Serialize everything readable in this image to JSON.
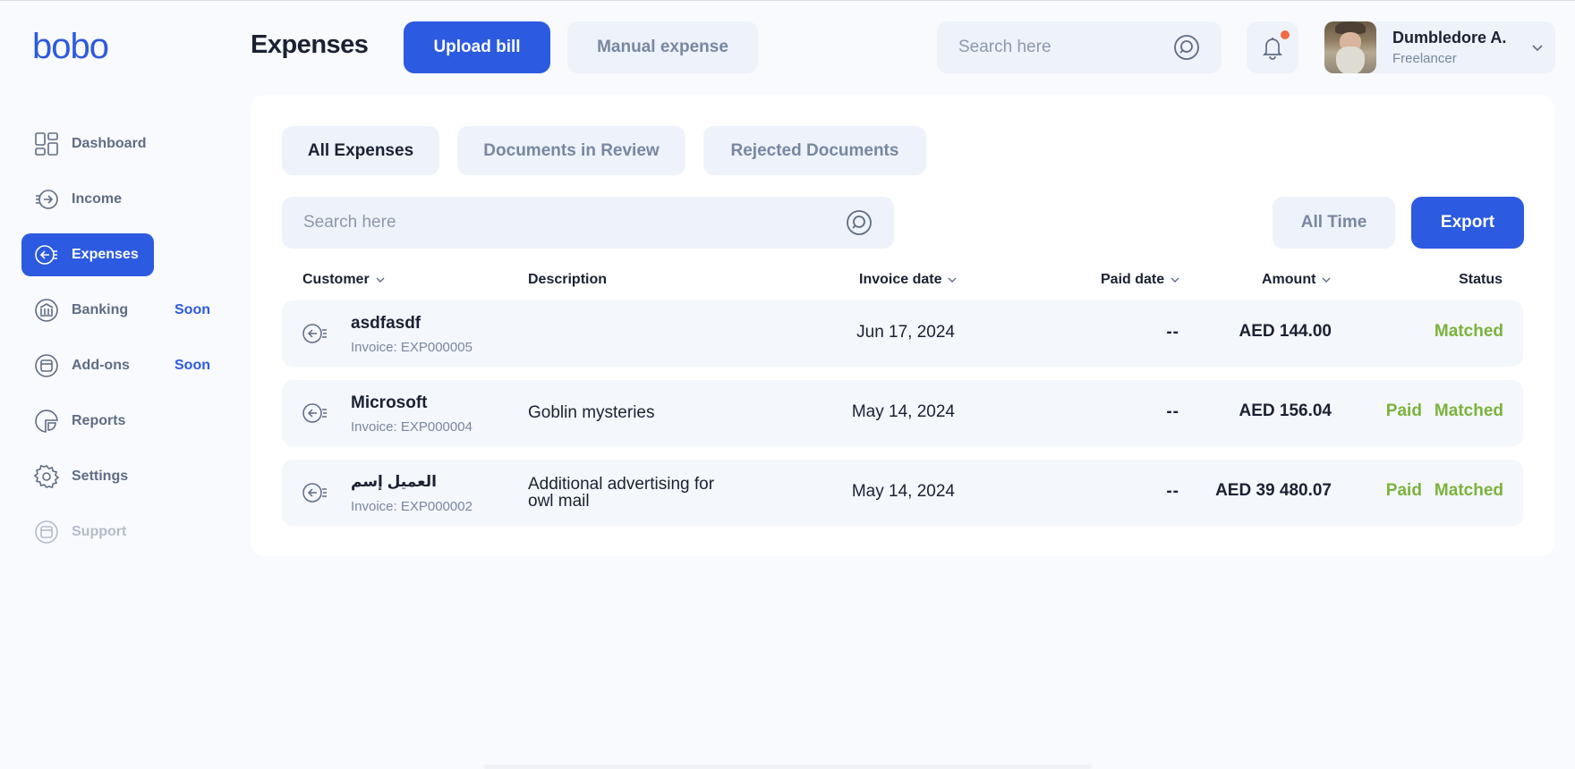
{
  "app": {
    "logo": "bobo",
    "page_title": "Expenses"
  },
  "header": {
    "upload_label": "Upload bill",
    "manual_label": "Manual expense",
    "search_placeholder": "Search here",
    "user": {
      "name": "Dumbledore A.",
      "role": "Freelancer"
    }
  },
  "sidebar": {
    "items": [
      {
        "label": "Dashboard",
        "icon": "dashboard-icon",
        "badge": ""
      },
      {
        "label": "Income",
        "icon": "income-icon",
        "badge": ""
      },
      {
        "label": "Expenses",
        "icon": "expenses-icon",
        "badge": ""
      },
      {
        "label": "Banking",
        "icon": "bank-icon",
        "badge": "Soon"
      },
      {
        "label": "Add-ons",
        "icon": "addons-icon",
        "badge": "Soon"
      },
      {
        "label": "Reports",
        "icon": "reports-icon",
        "badge": ""
      },
      {
        "label": "Settings",
        "icon": "gear-icon",
        "badge": ""
      },
      {
        "label": "Support",
        "icon": "support-icon",
        "badge": ""
      }
    ],
    "active": "Expenses"
  },
  "tabs": [
    "All Expenses",
    "Documents in Review",
    "Rejected Documents"
  ],
  "filters": {
    "search_placeholder": "Search here",
    "period_label": "All Time",
    "export_label": "Export"
  },
  "table": {
    "columns": [
      "Customer",
      "Description",
      "Invoice date",
      "Paid date",
      "Amount",
      "Status"
    ],
    "rows": [
      {
        "customer": "asdfasdf",
        "invoice": "Invoice: EXP000005",
        "description": "",
        "invoice_date": "Jun 17, 2024",
        "paid_date": "--",
        "amount": "AED 144.00",
        "paid": "",
        "status": "Matched"
      },
      {
        "customer": "Microsoft",
        "invoice": "Invoice: EXP000004",
        "description": "Goblin mysteries",
        "invoice_date": "May 14, 2024",
        "paid_date": "--",
        "amount": "AED 156.04",
        "paid": "Paid",
        "status": "Matched"
      },
      {
        "customer": "العميل إسم",
        "invoice": "Invoice: EXP000002",
        "description": "Additional advertising for owl mail",
        "invoice_date": "May 14, 2024",
        "paid_date": "--",
        "amount": "AED 39 480.07",
        "paid": "Paid",
        "status": "Matched"
      }
    ]
  },
  "colors": {
    "accent": "#2c5ae0",
    "status_green": "#7ab33a",
    "notification_dot": "#f26b43"
  }
}
